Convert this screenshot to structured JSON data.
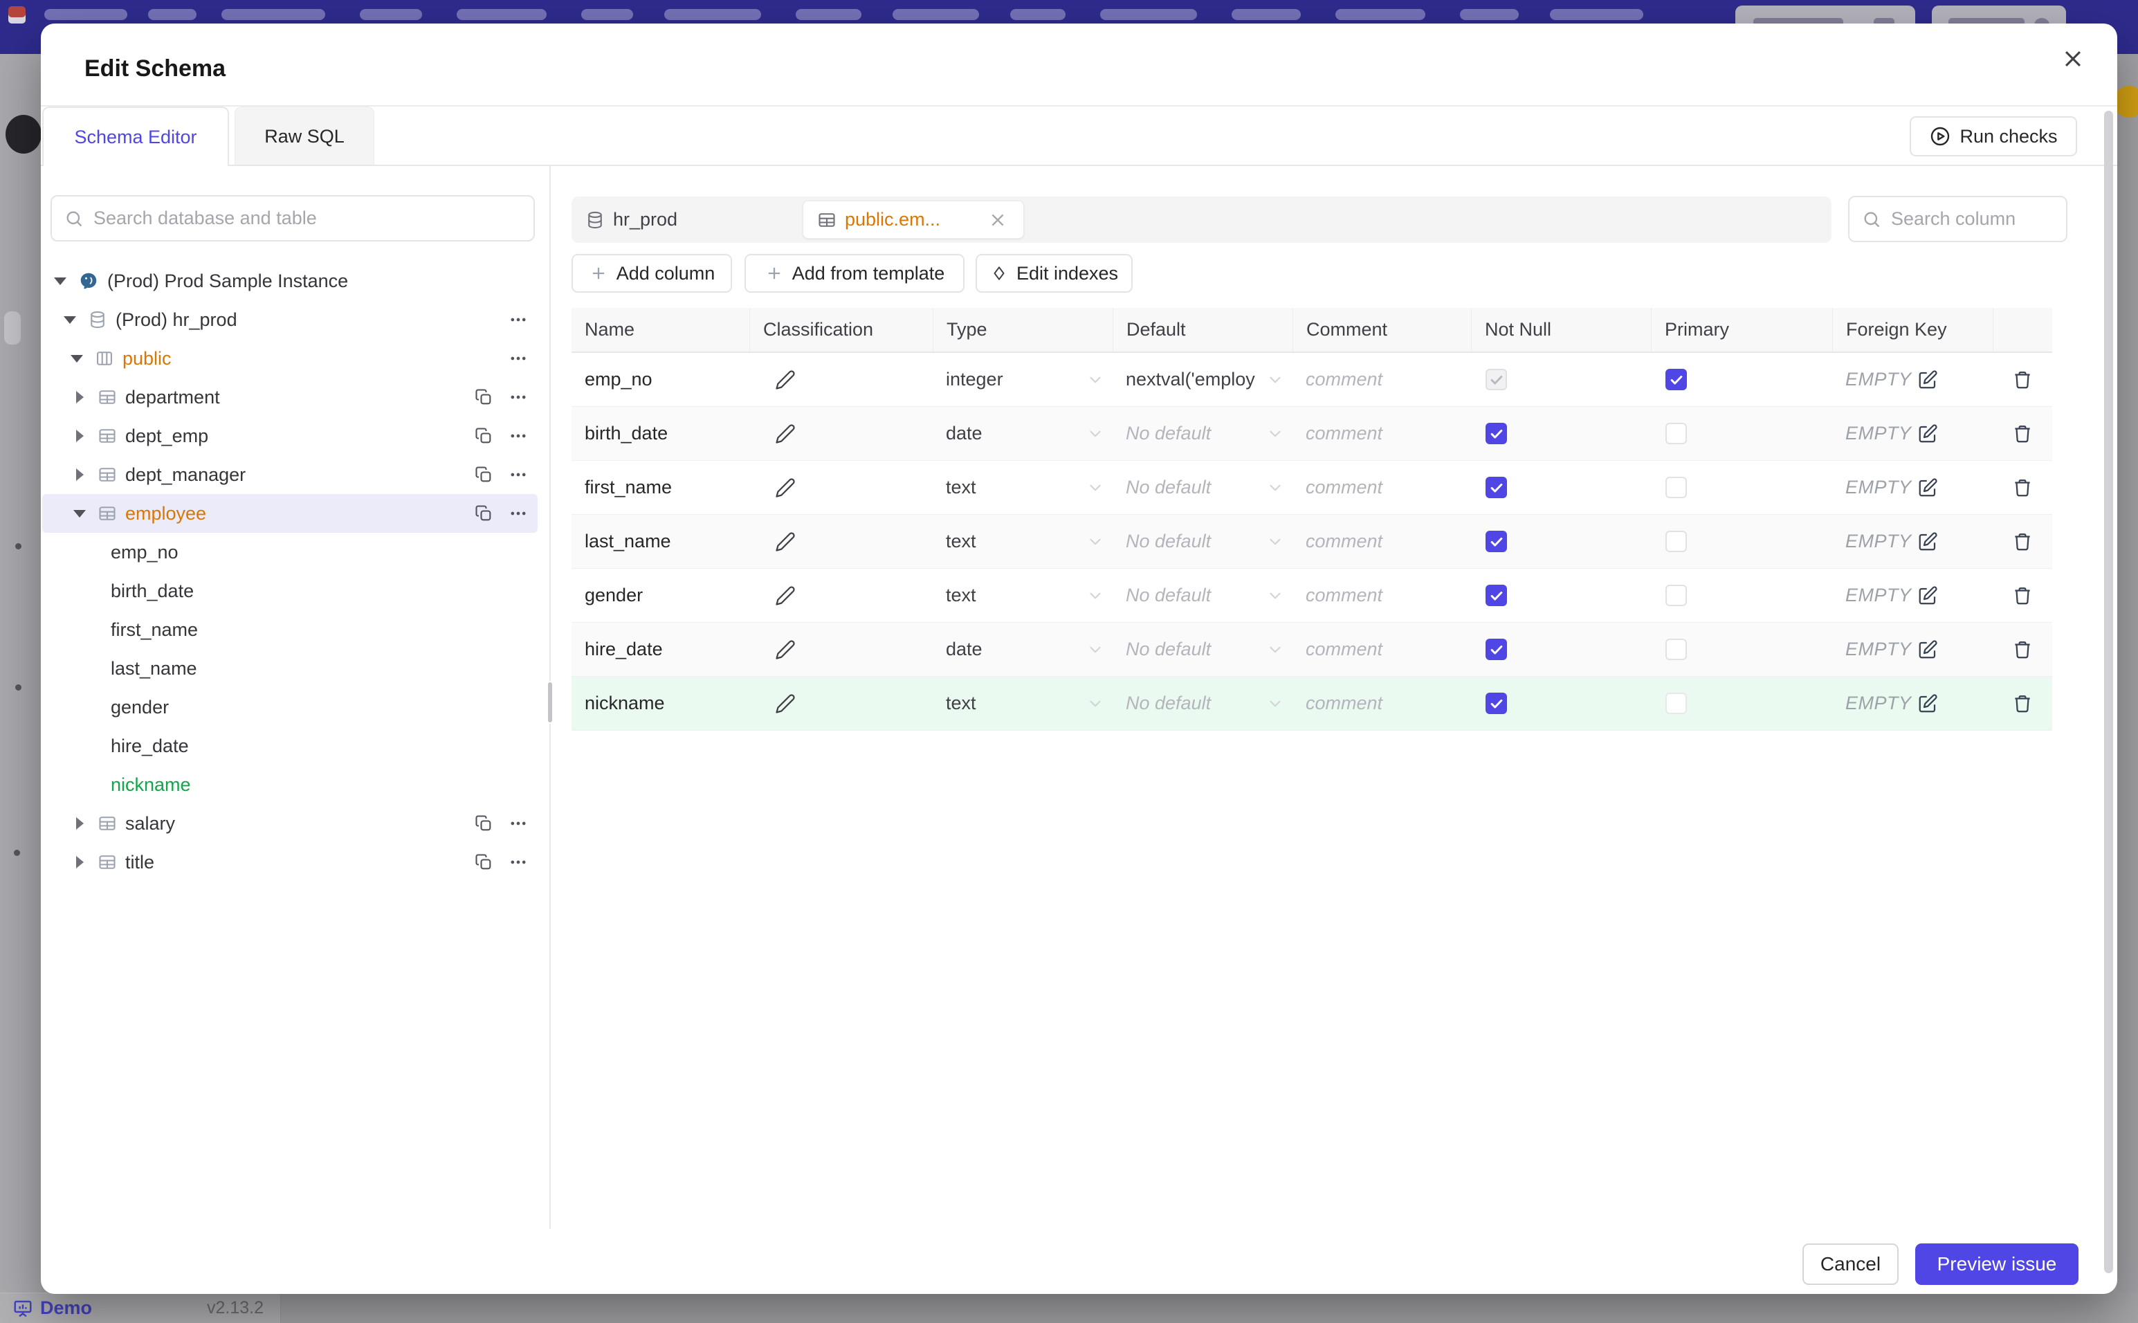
{
  "backdrop": {
    "demo_label": "Demo",
    "version": "v2.13.2"
  },
  "dialog": {
    "title": "Edit Schema",
    "tabs": [
      {
        "label": "Schema Editor",
        "active": true
      },
      {
        "label": "Raw SQL",
        "active": false
      }
    ],
    "run_checks_label": "Run checks"
  },
  "sidebar": {
    "search_placeholder": "Search database and table",
    "tree": [
      {
        "label": "(Prod) Prod Sample Instance",
        "type": "instance",
        "caret": "down"
      },
      {
        "label": "(Prod) hr_prod",
        "type": "database",
        "caret": "down",
        "menu": true
      },
      {
        "label": "public",
        "type": "schema",
        "caret": "down",
        "menu": true,
        "color": "amber"
      },
      {
        "label": "department",
        "type": "table",
        "caret": "right",
        "copy": true,
        "menu": true
      },
      {
        "label": "dept_emp",
        "type": "table",
        "caret": "right",
        "copy": true,
        "menu": true
      },
      {
        "label": "dept_manager",
        "type": "table",
        "caret": "right",
        "copy": true,
        "menu": true
      },
      {
        "label": "employee",
        "type": "table",
        "caret": "down",
        "copy": true,
        "menu": true,
        "color": "amber",
        "selected": true
      },
      {
        "label": "emp_no",
        "type": "column"
      },
      {
        "label": "birth_date",
        "type": "column"
      },
      {
        "label": "first_name",
        "type": "column"
      },
      {
        "label": "last_name",
        "type": "column"
      },
      {
        "label": "gender",
        "type": "column"
      },
      {
        "label": "hire_date",
        "type": "column"
      },
      {
        "label": "nickname",
        "type": "column",
        "color": "green"
      },
      {
        "label": "salary",
        "type": "table",
        "caret": "right",
        "copy": true,
        "menu": true
      },
      {
        "label": "title",
        "type": "table",
        "caret": "right",
        "copy": true,
        "menu": true
      }
    ]
  },
  "editor": {
    "chips": [
      {
        "label": "hr_prod",
        "icon": "database",
        "active": false
      },
      {
        "label": "public.em...",
        "icon": "table",
        "active": true
      }
    ],
    "search_placeholder": "Search column",
    "actions": [
      {
        "label": "Add column",
        "icon": "plus"
      },
      {
        "label": "Add from template",
        "icon": "plus"
      },
      {
        "label": "Edit indexes",
        "icon": "diamond"
      }
    ],
    "table": {
      "headers": [
        "Name",
        "Classification",
        "Type",
        "Default",
        "Comment",
        "Not Null",
        "Primary",
        "Foreign Key"
      ],
      "comment_placeholder": "comment",
      "fk_label": "EMPTY",
      "no_default_placeholder": "No default",
      "rows": [
        {
          "name": "emp_no",
          "type": "integer",
          "default": "nextval('employ",
          "not_null": "disabled",
          "primary": "on",
          "variant": "plain"
        },
        {
          "name": "birth_date",
          "type": "date",
          "default": "No default",
          "not_null": "on",
          "primary": "off",
          "variant": "zebra"
        },
        {
          "name": "first_name",
          "type": "text",
          "default": "No default",
          "not_null": "on",
          "primary": "off",
          "variant": "plain"
        },
        {
          "name": "last_name",
          "type": "text",
          "default": "No default",
          "not_null": "on",
          "primary": "off",
          "variant": "zebra"
        },
        {
          "name": "gender",
          "type": "text",
          "default": "No default",
          "not_null": "on",
          "primary": "off",
          "variant": "plain"
        },
        {
          "name": "hire_date",
          "type": "date",
          "default": "No default",
          "not_null": "on",
          "primary": "off",
          "variant": "zebra"
        },
        {
          "name": "nickname",
          "type": "text",
          "default": "No default",
          "not_null": "on",
          "primary": "off",
          "variant": "new"
        }
      ]
    }
  },
  "footer": {
    "cancel_label": "Cancel",
    "submit_label": "Preview issue"
  },
  "colors": {
    "accent": "#4f46e5",
    "amber": "#d97706",
    "green": "#16a34a",
    "navy": "#2e2b8d"
  }
}
